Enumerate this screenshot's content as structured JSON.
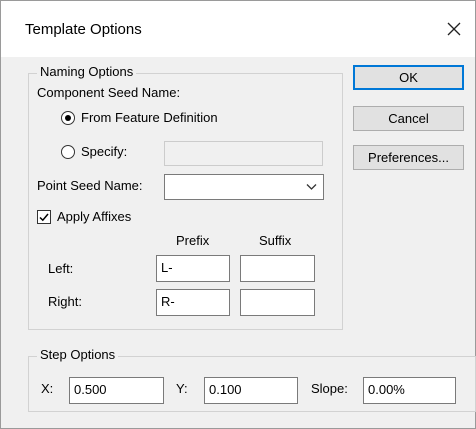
{
  "window": {
    "title": "Template Options"
  },
  "naming": {
    "legend": "Naming Options",
    "component_seed_label": "Component Seed Name:",
    "radio_feature_label": "From Feature Definition",
    "radio_specify_label": "Specify:",
    "specify_value": "",
    "point_seed_label": "Point Seed Name:",
    "point_seed_value": "",
    "apply_affixes_label": "Apply Affixes",
    "apply_affixes_checked": true,
    "prefix_header": "Prefix",
    "suffix_header": "Suffix",
    "left_label": "Left:",
    "right_label": "Right:",
    "left_prefix": "L-",
    "left_suffix": "",
    "right_prefix": "R-",
    "right_suffix": ""
  },
  "step": {
    "legend": "Step Options",
    "x_label": "X:",
    "x_value": "0.500",
    "y_label": "Y:",
    "y_value": "0.100",
    "slope_label": "Slope:",
    "slope_value": "0.00%"
  },
  "buttons": {
    "ok": "OK",
    "cancel": "Cancel",
    "preferences": "Preferences..."
  },
  "icons": {
    "close": "close-icon",
    "dropdown": "chevron-down-icon",
    "check": "checkmark-icon"
  },
  "colors": {
    "default_button_border": "#0078d7",
    "dialog_bg": "#f0f0f0"
  }
}
